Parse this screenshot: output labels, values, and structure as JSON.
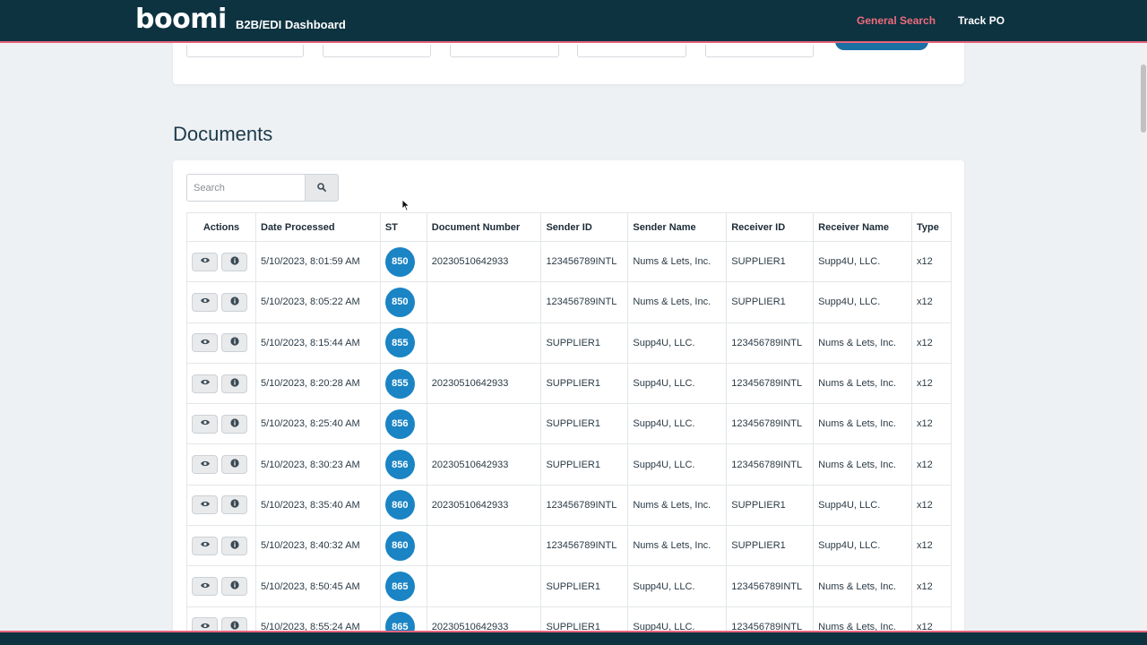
{
  "nav": {
    "brand": "boomi",
    "subtitle": "B2B/EDI Dashboard",
    "links": [
      "General Search",
      "Track PO"
    ]
  },
  "main": {
    "section_title": "Documents",
    "search_placeholder": "Search",
    "columns": [
      "Actions",
      "Date Processed",
      "ST",
      "Document Number",
      "Sender ID",
      "Sender Name",
      "Receiver ID",
      "Receiver Name",
      "Type"
    ],
    "rows": [
      {
        "date": "5/10/2023, 8:01:59 AM",
        "st": "850",
        "doc": "20230510642933",
        "sender_id": "123456789INTL",
        "sender_name": "Nums & Lets, Inc.",
        "receiver_id": "SUPPLIER1",
        "receiver_name": "Supp4U, LLC.",
        "type": "x12"
      },
      {
        "date": "5/10/2023, 8:05:22 AM",
        "st": "850",
        "doc": "",
        "sender_id": "123456789INTL",
        "sender_name": "Nums & Lets, Inc.",
        "receiver_id": "SUPPLIER1",
        "receiver_name": "Supp4U, LLC.",
        "type": "x12"
      },
      {
        "date": "5/10/2023, 8:15:44 AM",
        "st": "855",
        "doc": "",
        "sender_id": "SUPPLIER1",
        "sender_name": "Supp4U, LLC.",
        "receiver_id": "123456789INTL",
        "receiver_name": "Nums & Lets, Inc.",
        "type": "x12"
      },
      {
        "date": "5/10/2023, 8:20:28 AM",
        "st": "855",
        "doc": "20230510642933",
        "sender_id": "SUPPLIER1",
        "sender_name": "Supp4U, LLC.",
        "receiver_id": "123456789INTL",
        "receiver_name": "Nums & Lets, Inc.",
        "type": "x12"
      },
      {
        "date": "5/10/2023, 8:25:40 AM",
        "st": "856",
        "doc": "",
        "sender_id": "SUPPLIER1",
        "sender_name": "Supp4U, LLC.",
        "receiver_id": "123456789INTL",
        "receiver_name": "Nums & Lets, Inc.",
        "type": "x12"
      },
      {
        "date": "5/10/2023, 8:30:23 AM",
        "st": "856",
        "doc": "20230510642933",
        "sender_id": "SUPPLIER1",
        "sender_name": "Supp4U, LLC.",
        "receiver_id": "123456789INTL",
        "receiver_name": "Nums & Lets, Inc.",
        "type": "x12"
      },
      {
        "date": "5/10/2023, 8:35:40 AM",
        "st": "860",
        "doc": "20230510642933",
        "sender_id": "123456789INTL",
        "sender_name": "Nums & Lets, Inc.",
        "receiver_id": "SUPPLIER1",
        "receiver_name": "Supp4U, LLC.",
        "type": "x12"
      },
      {
        "date": "5/10/2023, 8:40:32 AM",
        "st": "860",
        "doc": "",
        "sender_id": "123456789INTL",
        "sender_name": "Nums & Lets, Inc.",
        "receiver_id": "SUPPLIER1",
        "receiver_name": "Supp4U, LLC.",
        "type": "x12"
      },
      {
        "date": "5/10/2023, 8:50:45 AM",
        "st": "865",
        "doc": "",
        "sender_id": "SUPPLIER1",
        "sender_name": "Supp4U, LLC.",
        "receiver_id": "123456789INTL",
        "receiver_name": "Nums & Lets, Inc.",
        "type": "x12"
      },
      {
        "date": "5/10/2023, 8:55:24 AM",
        "st": "865",
        "doc": "20230510642933",
        "sender_id": "SUPPLIER1",
        "sender_name": "Supp4U, LLC.",
        "receiver_id": "123456789INTL",
        "receiver_name": "Nums & Lets, Inc.",
        "type": "x12"
      }
    ]
  },
  "icons": {
    "view": "eye-icon",
    "info": "info-icon",
    "search": "search-icon"
  },
  "colors": {
    "navbar": "#0d3240",
    "accent": "#e9637d",
    "badge": "#1a84c4"
  }
}
